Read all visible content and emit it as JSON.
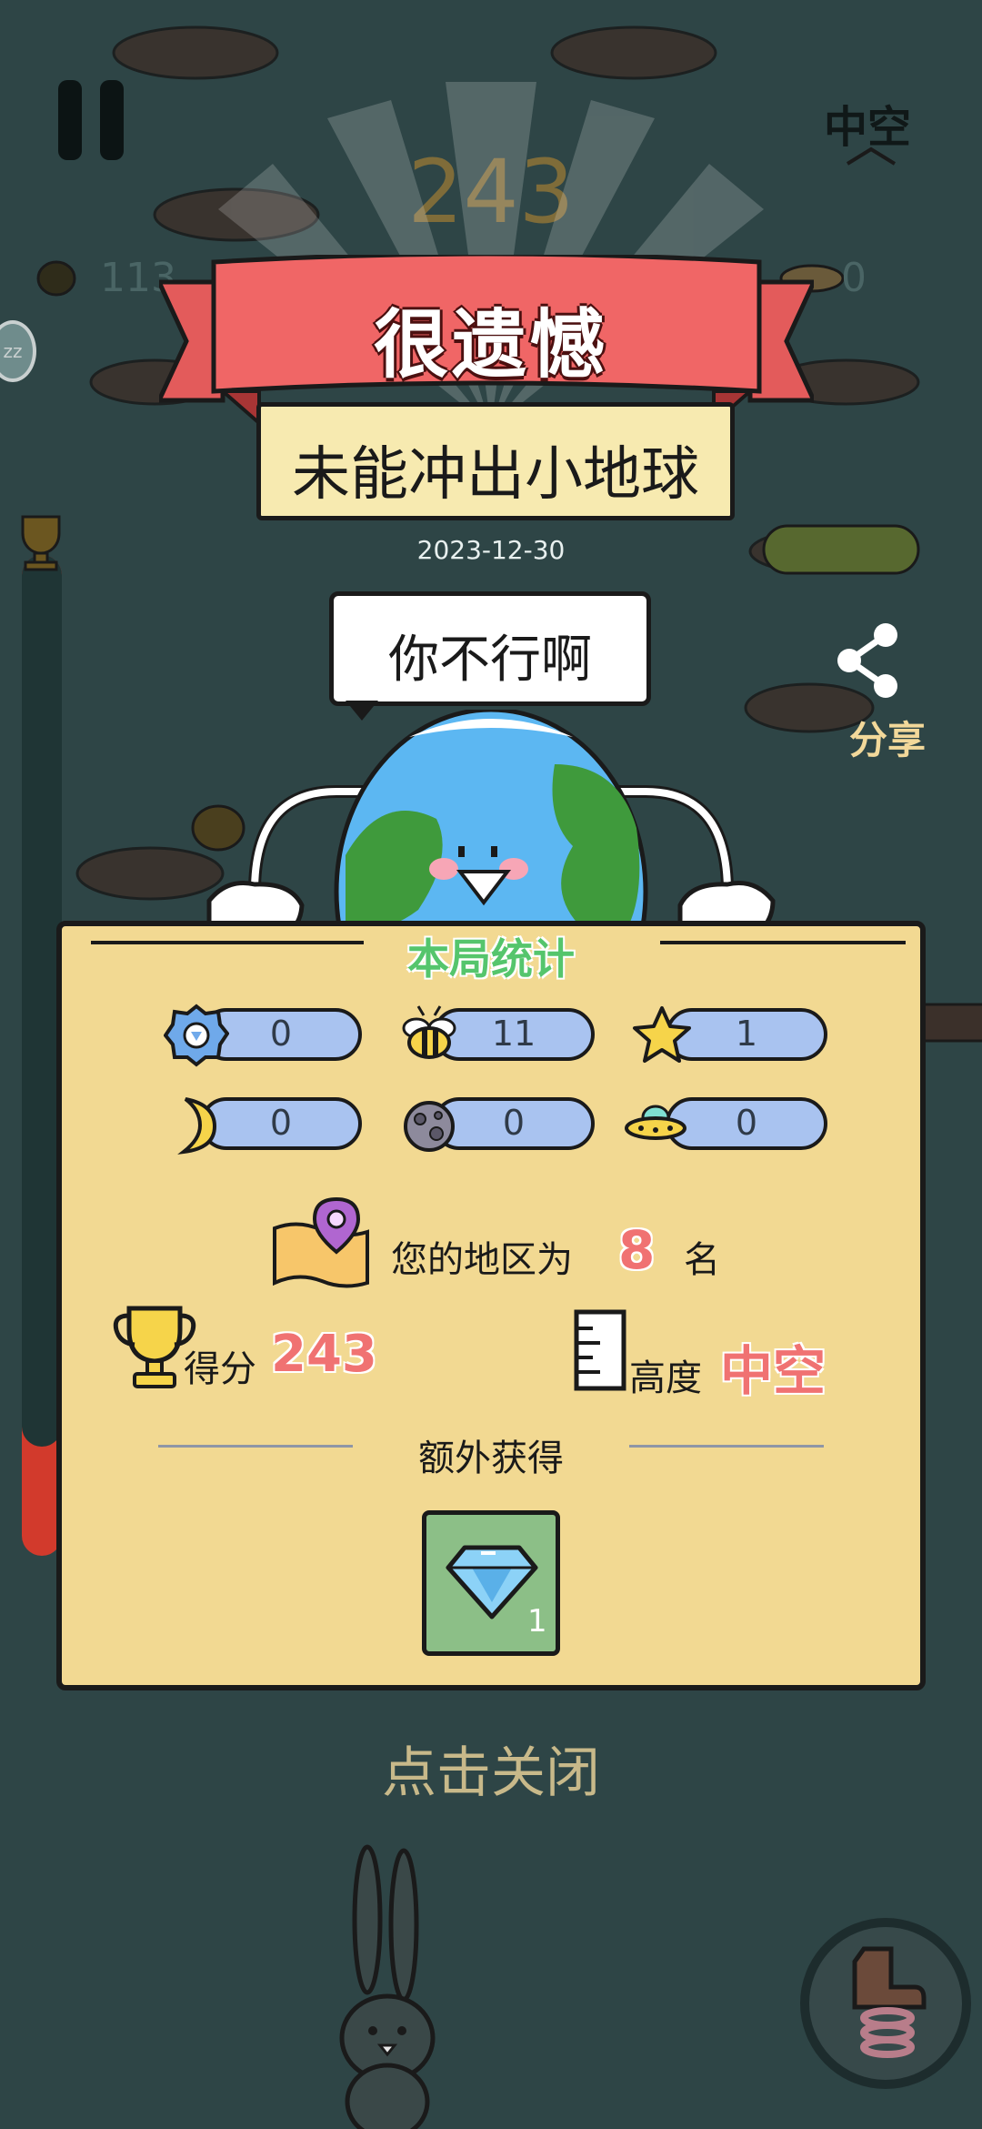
{
  "hud": {
    "altitude_label": "中空",
    "background_score": "243",
    "bee_count": "113",
    "ufo_count": "0",
    "sleep_badge": "zz"
  },
  "result": {
    "title": "很遗憾",
    "subtitle": "未能冲出小地球",
    "date": "2023-12-30",
    "speech": "你不行啊"
  },
  "share": {
    "label": "分享"
  },
  "stats_panel": {
    "title": "本局统计",
    "items": [
      {
        "icon": "gear-shield-icon",
        "value": "0"
      },
      {
        "icon": "bee-icon",
        "value": "11"
      },
      {
        "icon": "star-icon",
        "value": "1"
      },
      {
        "icon": "moon-icon",
        "value": "0"
      },
      {
        "icon": "asteroid-icon",
        "value": "0"
      },
      {
        "icon": "ufo-icon",
        "value": "0"
      }
    ],
    "rank_label": "您的地区为",
    "rank_value": "8",
    "rank_unit": "名",
    "score_label": "得分",
    "score_value": "243",
    "height_label": "高度",
    "height_value": "中空",
    "extra_label": "额外获得",
    "reward": {
      "icon": "diamond-icon",
      "count": "1"
    }
  },
  "close_label": "点击关闭",
  "colors": {
    "background": "#2e4546",
    "banner_red": "#f06666",
    "panel": "#f2d992",
    "pill": "#a9c3f0",
    "accent_red": "#f07272",
    "title_green": "#55c56c"
  }
}
